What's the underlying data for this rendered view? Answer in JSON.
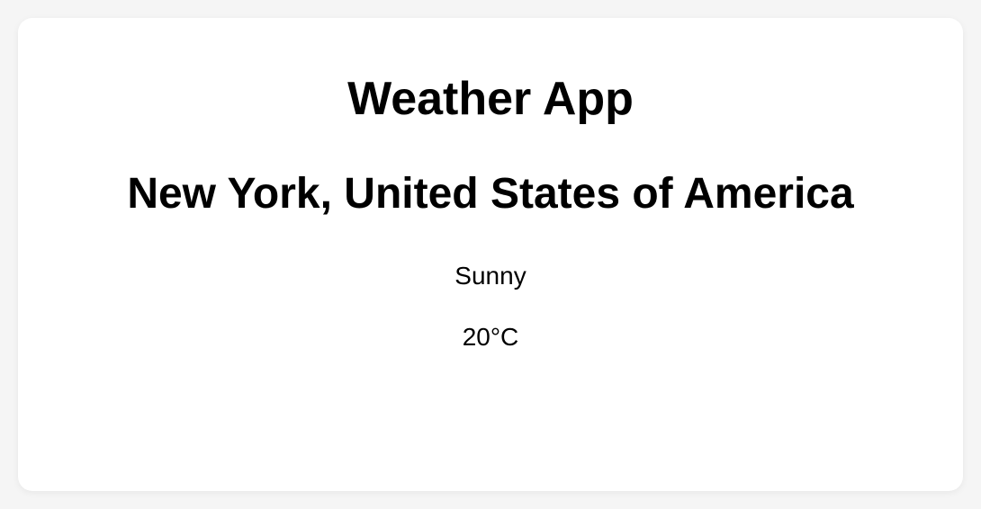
{
  "header": {
    "title": "Weather App"
  },
  "weather": {
    "location": "New York, United States of America",
    "condition": "Sunny",
    "temperature": "20°C"
  }
}
